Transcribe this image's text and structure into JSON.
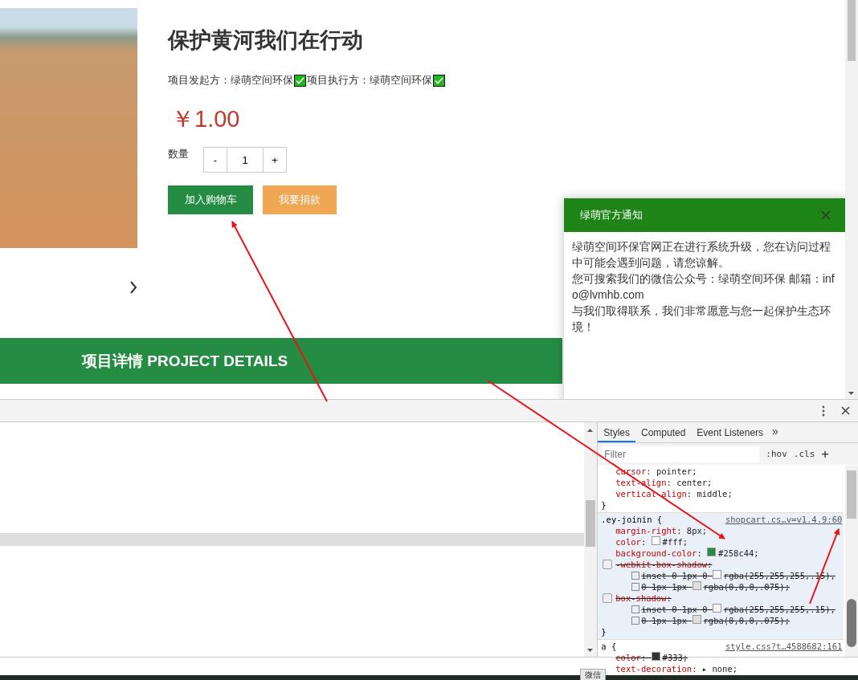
{
  "product": {
    "title": "保护黄河我们在行动",
    "parties": [
      {
        "label": "项目发起方：绿萌空间环保",
        "verified": true
      },
      {
        "label": "项目执行方：绿萌空间环保",
        "verified": true
      }
    ],
    "price": "￥1.00",
    "quantity_label": "数量",
    "decrement": "-",
    "quantity": "1",
    "increment": "+",
    "buttons": [
      {
        "label": "加入购物车",
        "kind": "primary"
      },
      {
        "label": "我要捐款",
        "kind": "secondary"
      }
    ]
  },
  "section_banner": "项目详情 PROJECT DETAILS",
  "notification": {
    "title": "绿萌官方通知",
    "lines": [
      "绿萌空间环保官网正在进行系统升级，您在访问过程中可能会遇到问题，请您谅解。",
      "您可搜索我们的微信公众号：绿萌空间环保 邮箱：info@lvmhb.com",
      "与我们取得联系，我们非常愿意与您一起保护生态环境！"
    ]
  },
  "devtools": {
    "tabs": [
      {
        "label": "Styles",
        "selected": true
      },
      {
        "label": "Computed",
        "selected": false
      },
      {
        "label": "Event Listeners",
        "selected": false
      }
    ],
    "more_tabs": "»",
    "filter_placeholder": "Filter",
    "hov": ":hov",
    "cls": ".cls",
    "add": "+",
    "rules": [
      {
        "highlighted": false,
        "declarations": [
          {
            "property": "cursor",
            "colon": ":",
            "value": "pointer;",
            "struck": false
          },
          {
            "property": "text-align",
            "colon": ":",
            "value": "center;",
            "struck": false
          },
          {
            "property": "vertical-align",
            "colon": ":",
            "value": "middle;",
            "struck": false
          }
        ],
        "close": "}"
      },
      {
        "selector": ".ey-joinin {",
        "source": "shopcart.cs…v=v1.4.9:60",
        "highlighted": true,
        "declarations": [
          {
            "property": "margin-right",
            "colon": ":",
            "value": "8px;",
            "struck": false
          },
          {
            "property": "color",
            "colon": ":",
            "color": "#ffffff",
            "value": "#fff;",
            "struck": false
          },
          {
            "property": "background-color",
            "colon": ":",
            "color": "#258c44",
            "value": "#258c44;",
            "struck": false
          },
          {
            "property": "-webkit-box-shadow",
            "colon": ":",
            "struck": true,
            "checked": false,
            "parts": [
              {
                "color": "#f4f4f4",
                "pre": "inset 0 1px 0",
                "value": "rgba(255,255,255,.15),"
              },
              {
                "color": "#dddddd",
                "pre": "0 1px 1px",
                "value": "rgba(0,0,0,.075);"
              }
            ]
          },
          {
            "property": "box-shadow",
            "colon": ":",
            "struck": true,
            "checked": false,
            "parts": [
              {
                "color": "#f4f4f4",
                "pre": "inset 0 1px 0",
                "value": "rgba(255,255,255,.15),"
              },
              {
                "color": "#dddddd",
                "pre": "0 1px 1px",
                "value": "rgba(0,0,0,.075);"
              }
            ]
          }
        ],
        "close": "}"
      },
      {
        "selector": "a {",
        "source": "style.css?t…4588682:161",
        "highlighted": false,
        "declarations": [
          {
            "property": "color",
            "colon": ":",
            "color": "#333333",
            "value": "#333;",
            "struck": true
          },
          {
            "property": "text-decoration",
            "colon": ":",
            "value": "▸ none;",
            "struck": false
          }
        ]
      }
    ]
  },
  "taskbar": {
    "tooltip": "微信"
  }
}
